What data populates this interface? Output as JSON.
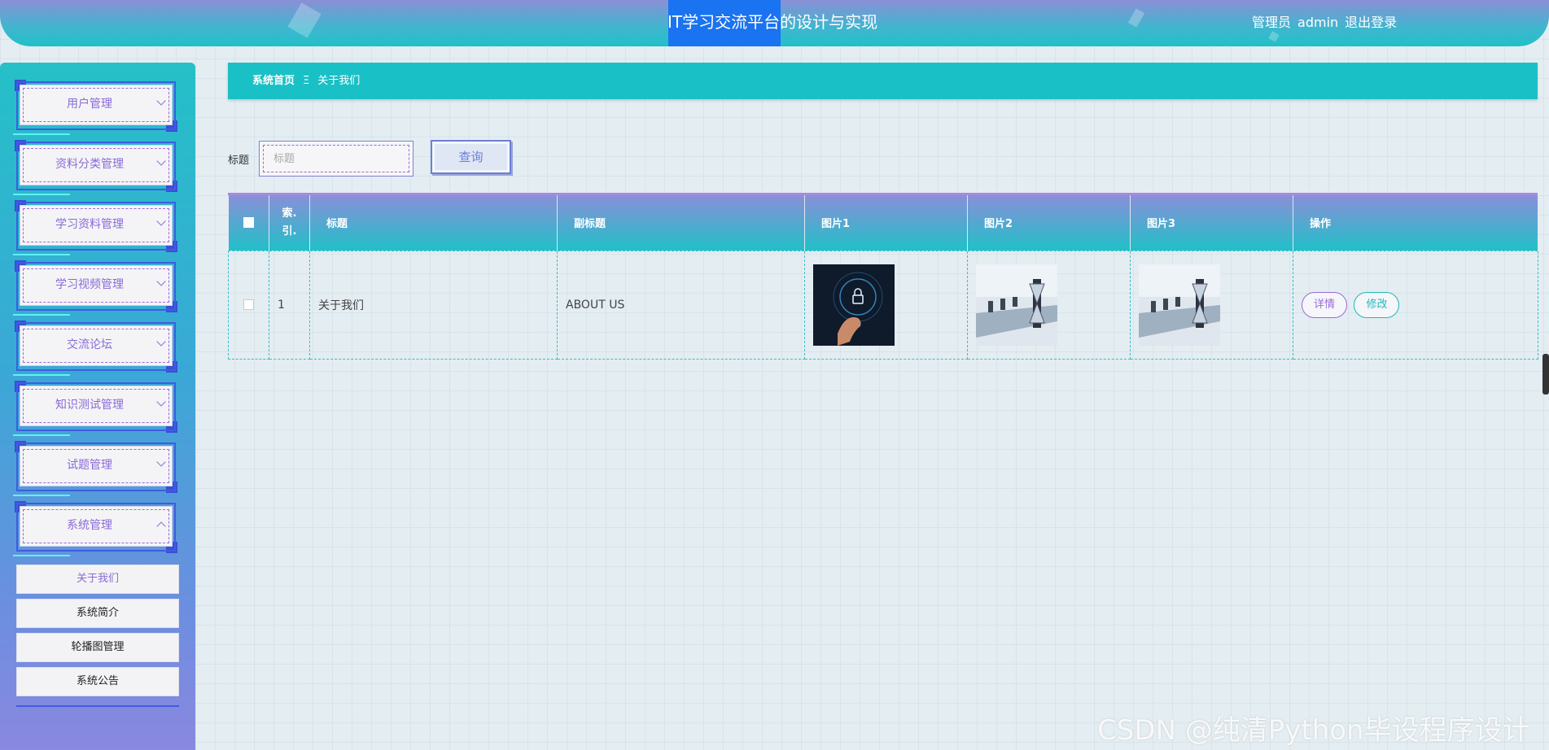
{
  "header": {
    "title": "IT学习交流平台的设计与实现",
    "user_role": "管理员",
    "username": "admin",
    "logout_label": "退出登录"
  },
  "sidebar": {
    "items": [
      {
        "label": "用户管理"
      },
      {
        "label": "资料分类管理"
      },
      {
        "label": "学习资料管理"
      },
      {
        "label": "学习视频管理"
      },
      {
        "label": "交流论坛"
      },
      {
        "label": "知识测试管理"
      },
      {
        "label": "试题管理"
      },
      {
        "label": "系统管理"
      }
    ],
    "sub_items": [
      {
        "label": "关于我们"
      },
      {
        "label": "系统简介"
      },
      {
        "label": "轮播图管理"
      },
      {
        "label": "系统公告"
      }
    ]
  },
  "breadcrumb": {
    "home": "系统首页",
    "separator": "Ξ",
    "current": "关于我们"
  },
  "search": {
    "label": "标题",
    "placeholder": "标题",
    "button_label": "查询"
  },
  "table": {
    "headers": {
      "index": "索引",
      "index_line1": "索.",
      "index_line2": "引.",
      "title": "标题",
      "subtitle": "副标题",
      "image1": "图片1",
      "image2": "图片2",
      "image3": "图片3",
      "actions": "操作"
    },
    "rows": [
      {
        "index": "1",
        "title": "关于我们",
        "subtitle": "ABOUT US",
        "image1": "hand-lock-icon",
        "image2": "conference-room-hourglass",
        "image3": "conference-room-hourglass",
        "detail_label": "详情",
        "edit_label": "修改"
      }
    ]
  },
  "watermark": "CSDN @纯清Python毕设程序设计",
  "colors": {
    "accent_teal": "#19c1c6",
    "accent_purple": "#8a6bd6",
    "header_highlight": "#1a73f0"
  }
}
